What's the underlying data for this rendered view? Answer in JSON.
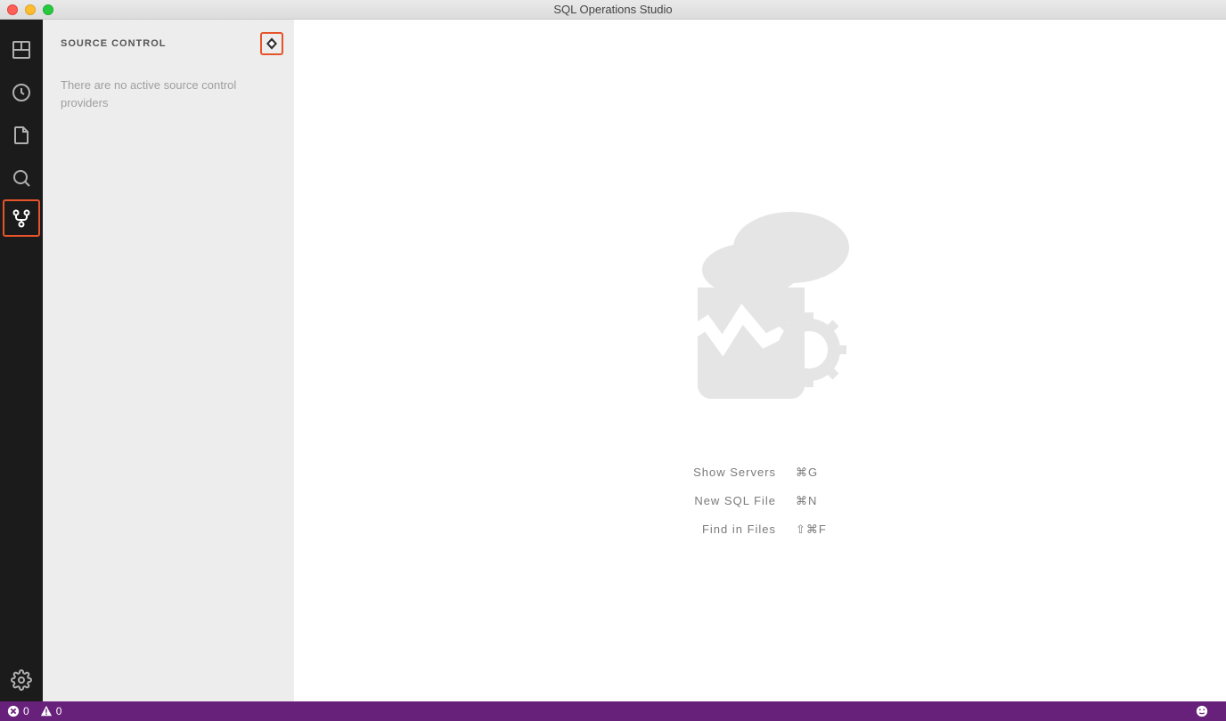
{
  "window": {
    "title": "SQL Operations Studio"
  },
  "sidebar": {
    "title": "SOURCE CONTROL",
    "message": "There are no active source control providers"
  },
  "welcome": {
    "shortcuts": [
      {
        "label": "Show Servers",
        "keys": "⌘G"
      },
      {
        "label": "New SQL File",
        "keys": "⌘N"
      },
      {
        "label": "Find in Files",
        "keys": "⇧⌘F"
      }
    ]
  },
  "status": {
    "errors": "0",
    "warnings": "0"
  }
}
